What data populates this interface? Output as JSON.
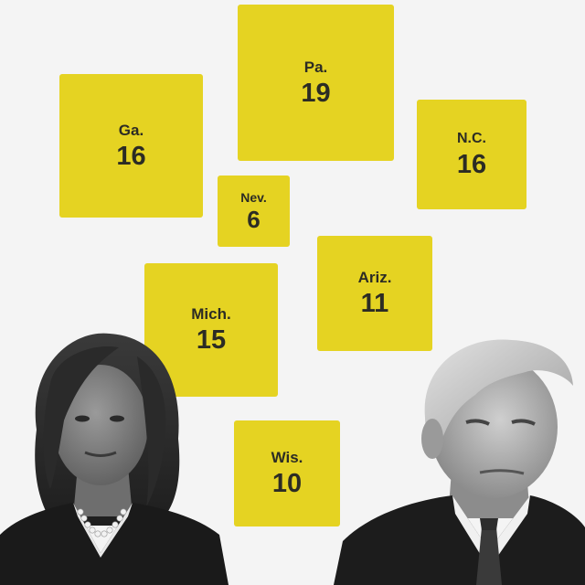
{
  "states": [
    {
      "abbr": "Pa.",
      "votes": "19"
    },
    {
      "abbr": "Ga.",
      "votes": "16"
    },
    {
      "abbr": "N.C.",
      "votes": "16"
    },
    {
      "abbr": "Nev.",
      "votes": "6"
    },
    {
      "abbr": "Ariz.",
      "votes": "11"
    },
    {
      "abbr": "Mich.",
      "votes": "15"
    },
    {
      "abbr": "Wis.",
      "votes": "10"
    }
  ],
  "colors": {
    "background": "#f4f4f4",
    "tile": "#e5d322",
    "tile_text": "#2c2c24"
  }
}
